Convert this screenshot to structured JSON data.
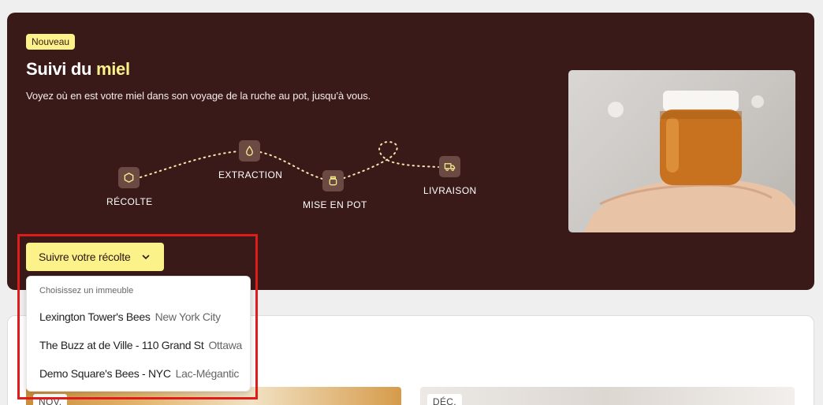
{
  "hero": {
    "badge": "Nouveau",
    "title_main": "Suivi du ",
    "title_accent": "miel",
    "subtitle": "Voyez où en est votre miel dans son voyage de la ruche au pot, jusqu'à vous.",
    "steps": [
      {
        "label": "RÉCOLTE",
        "icon": "hexagon-icon"
      },
      {
        "label": "EXTRACTION",
        "icon": "honey-drop-icon"
      },
      {
        "label": "MISE EN POT",
        "icon": "jar-icon"
      },
      {
        "label": "LIVRAISON",
        "icon": "truck-icon"
      }
    ],
    "track_button": "Suivre votre récolte"
  },
  "dropdown": {
    "header": "Choisissez un immeuble",
    "items": [
      {
        "name": "Lexington Tower's Bees",
        "city": "New York City"
      },
      {
        "name": "The Buzz at de Ville - 110 Grand St",
        "city": "Ottawa"
      },
      {
        "name": "Demo Square's Bees - NYC",
        "city": "Lac-Mégantic"
      }
    ]
  },
  "lower": {
    "months": [
      "NOV.",
      "DÉC."
    ]
  },
  "colors": {
    "hero_bg": "#3a1a18",
    "accent_yellow": "#fbf28a",
    "highlight_red": "#e01b1b"
  }
}
